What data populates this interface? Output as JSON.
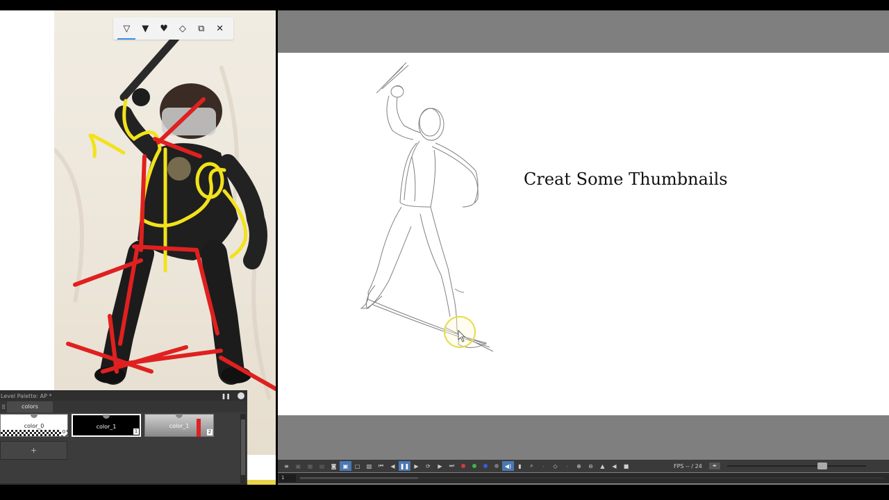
{
  "toolbar": {
    "tools": [
      {
        "icon": "pen-tool-icon",
        "glyph": "▽",
        "active": true
      },
      {
        "icon": "brush-tool-icon",
        "glyph": "▼"
      },
      {
        "icon": "fountain-pen-icon",
        "glyph": "♥"
      },
      {
        "icon": "eraser-icon",
        "glyph": "◇"
      },
      {
        "icon": "copy-icon",
        "glyph": "⧉"
      },
      {
        "icon": "close-icon",
        "glyph": "✕"
      }
    ]
  },
  "palette": {
    "title": "Level Palette: AP *",
    "tab": "colors",
    "chips": [
      {
        "label": "color_0",
        "index": "0"
      },
      {
        "label": "color_1",
        "index": "1"
      },
      {
        "label": "color_1",
        "index": "2"
      }
    ],
    "add_label": "+"
  },
  "canvas": {
    "title": "Creat Some Thumbnails"
  },
  "playback": {
    "fps_label": "FPS -- / 24",
    "frame": "1"
  },
  "colors": {
    "annotation_yellow": "#f2e21b",
    "annotation_red": "#e02020",
    "cursor_ring": "#e6dc4a",
    "accent_blue": "#4a78b5"
  }
}
